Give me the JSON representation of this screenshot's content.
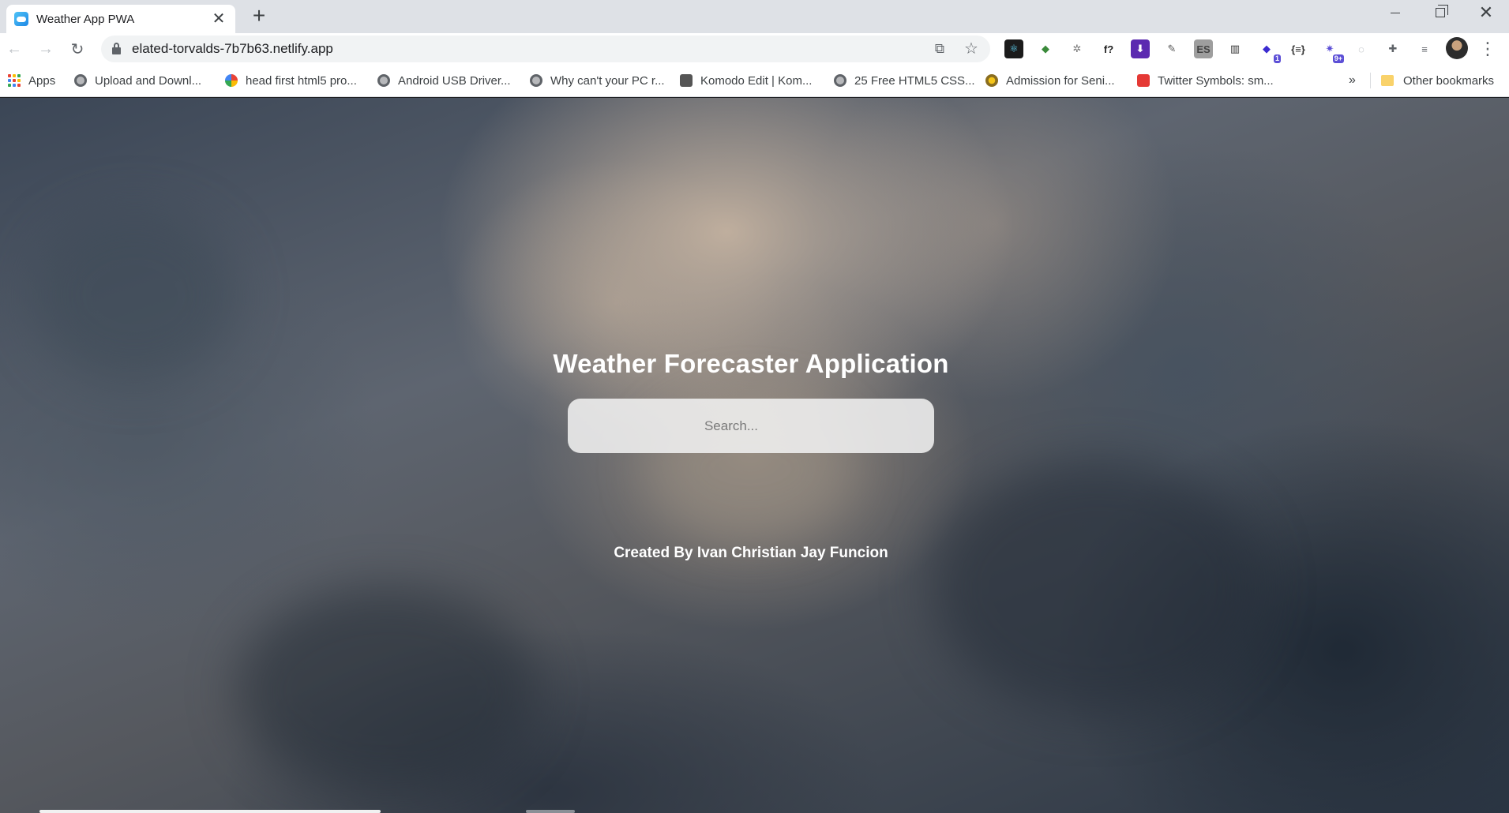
{
  "tab": {
    "title": "Weather App PWA",
    "close": "✕",
    "new_tab": "+"
  },
  "window_controls": {
    "close": "✕"
  },
  "toolbar": {
    "back": "←",
    "forward": "→",
    "reload": "↻",
    "url": "elated-torvalds-7b7b63.netlify.app",
    "open_icon": "⧉",
    "star_icon": "☆",
    "menu": "⋮"
  },
  "extensions": [
    {
      "name": "react-devtools-icon",
      "glyph": "⚛",
      "color": "#1b1b1b",
      "fg": "#61dafb"
    },
    {
      "name": "earth-extension-icon",
      "glyph": "◆",
      "color": "#ffffff",
      "fg": "#3a8a3a"
    },
    {
      "name": "gear-extension-icon",
      "glyph": "✲",
      "color": "#ffffff",
      "fg": "#777777"
    },
    {
      "name": "whatfont-icon",
      "glyph": "f?",
      "color": "#ffffff",
      "fg": "#222222"
    },
    {
      "name": "download-extension-icon",
      "glyph": "⬇",
      "color": "#5b2ab0",
      "fg": "#ffffff"
    },
    {
      "name": "eyedropper-icon",
      "glyph": "✎",
      "color": "#ffffff",
      "fg": "#555555"
    },
    {
      "name": "es-extension-icon",
      "glyph": "ES",
      "color": "#9e9e9e",
      "fg": "#444444"
    },
    {
      "name": "columns-extension-icon",
      "glyph": "▥",
      "color": "#ffffff",
      "fg": "#333333"
    },
    {
      "name": "graduation-extension-icon",
      "glyph": "◆",
      "color": "#ffffff",
      "fg": "#3b2bd0",
      "badge": "1"
    },
    {
      "name": "json-extension-icon",
      "glyph": "{≡}",
      "color": "#ffffff",
      "fg": "#333333"
    },
    {
      "name": "spark-extension-icon",
      "glyph": "✷",
      "color": "#ffffff",
      "fg": "#5c4fd6",
      "badge": "9+"
    },
    {
      "name": "circle-extension-icon",
      "glyph": "◌",
      "color": "#ffffff",
      "fg": "#9aa0a6"
    },
    {
      "name": "puzzle-icon",
      "glyph": "✚",
      "color": "#ffffff",
      "fg": "#5f6368"
    },
    {
      "name": "reading-list-icon",
      "glyph": "≡",
      "color": "#ffffff",
      "fg": "#5f6368"
    }
  ],
  "bookmarks": {
    "apps": "Apps",
    "items": [
      "Upload and Downl...",
      "head first html5 pro...",
      "Android USB Driver...",
      "Why can't your PC r...",
      "Komodo Edit | Kom...",
      "25 Free HTML5 CSS...",
      "Admission for Seni...",
      "Twitter Symbols: sm..."
    ],
    "overflow": "»",
    "other": "Other bookmarks"
  },
  "page": {
    "title": "Weather Forecaster Application",
    "search_placeholder": "Search...",
    "credit": "Created By Ivan Christian Jay Funcion"
  }
}
